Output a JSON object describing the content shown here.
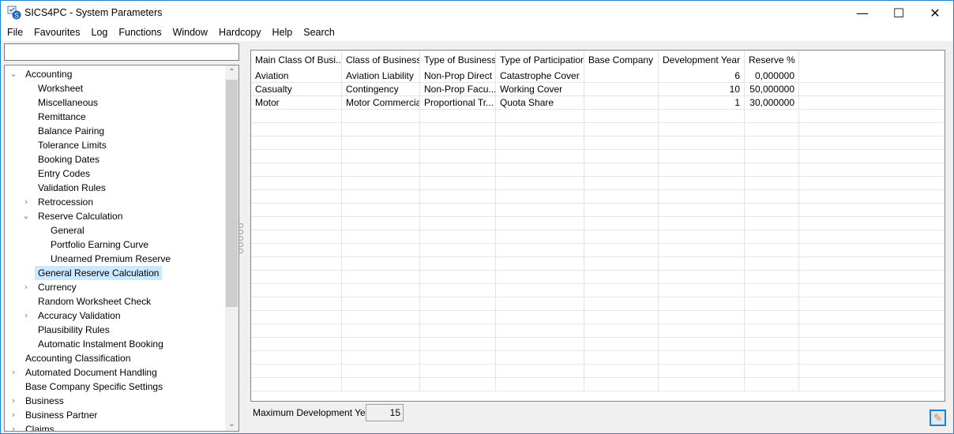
{
  "window": {
    "title": "SICS4PC - System Parameters",
    "minimize": "—",
    "maximize": "☐",
    "close": "✕"
  },
  "menu": [
    "File",
    "Favourites",
    "Log",
    "Functions",
    "Window",
    "Hardcopy",
    "Help",
    "Search"
  ],
  "search": {
    "value": "",
    "placeholder": ""
  },
  "tree": [
    {
      "label": "Accounting",
      "level": 0,
      "state": "expanded"
    },
    {
      "label": "Worksheet",
      "level": 1
    },
    {
      "label": "Miscellaneous",
      "level": 1
    },
    {
      "label": "Remittance",
      "level": 1
    },
    {
      "label": "Balance Pairing",
      "level": 1
    },
    {
      "label": "Tolerance Limits",
      "level": 1
    },
    {
      "label": "Booking Dates",
      "level": 1
    },
    {
      "label": "Entry Codes",
      "level": 1
    },
    {
      "label": "Validation Rules",
      "level": 1
    },
    {
      "label": "Retrocession",
      "level": 1,
      "state": "collapsed"
    },
    {
      "label": "Reserve Calculation",
      "level": 1,
      "state": "expanded"
    },
    {
      "label": "General",
      "level": 2
    },
    {
      "label": "Portfolio Earning Curve",
      "level": 2
    },
    {
      "label": "Unearned Premium Reserve",
      "level": 2
    },
    {
      "label": "General Reserve Calculation",
      "level": 1,
      "selected": true
    },
    {
      "label": "Currency",
      "level": 1,
      "state": "collapsed"
    },
    {
      "label": "Random Worksheet Check",
      "level": 1
    },
    {
      "label": "Accuracy Validation",
      "level": 1,
      "state": "collapsed"
    },
    {
      "label": "Plausibility Rules",
      "level": 1
    },
    {
      "label": "Automatic Instalment Booking",
      "level": 1
    },
    {
      "label": "Accounting Classification",
      "level": 0
    },
    {
      "label": "Automated Document Handling",
      "level": 0,
      "state": "collapsed"
    },
    {
      "label": "Base Company Specific Settings",
      "level": 0
    },
    {
      "label": "Business",
      "level": 0,
      "state": "collapsed"
    },
    {
      "label": "Business Partner",
      "level": 0,
      "state": "collapsed"
    },
    {
      "label": "Claims",
      "level": 0,
      "state": "collapsed"
    }
  ],
  "grid": {
    "columns": [
      {
        "label": "Main Class Of Busi...",
        "align": "left"
      },
      {
        "label": "Class of Business",
        "align": "left"
      },
      {
        "label": "Type of Business",
        "align": "left"
      },
      {
        "label": "Type of Participation",
        "align": "left"
      },
      {
        "label": "Base Company",
        "align": "left"
      },
      {
        "label": "Development Year",
        "align": "right"
      },
      {
        "label": "Reserve %",
        "align": "right"
      }
    ],
    "rows": [
      [
        "Aviation",
        "Aviation Liability",
        "Non-Prop Direct",
        "Catastrophe Cover",
        "",
        "6",
        "0,000000"
      ],
      [
        "Casualty",
        "Contingency",
        "Non-Prop Facu...",
        "Working Cover",
        "",
        "10",
        "50,000000"
      ],
      [
        "Motor",
        "Motor Commercial",
        "Proportional Tr...",
        "Quota Share",
        "",
        "1",
        "30,000000"
      ]
    ]
  },
  "footer": {
    "max_dev_years_label": "Maximum Development Years",
    "max_dev_years_value": "15",
    "edit_icon": "pencil-icon"
  },
  "colors": {
    "accent": "#1883d7",
    "selection": "#cce8ff"
  }
}
